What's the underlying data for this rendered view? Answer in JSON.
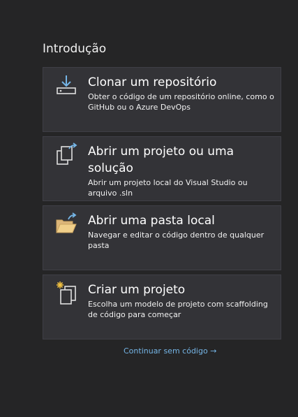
{
  "section": {
    "title": "Introdução"
  },
  "cards": [
    {
      "icon": "clone-repository-icon",
      "title": "Clonar um repositório",
      "description": "Obter o código de um repositório online, como o GitHub ou o Azure DevOps"
    },
    {
      "icon": "open-project-icon",
      "title": "Abrir um projeto ou uma solução",
      "description": "Abrir um projeto local do Visual Studio ou arquivo .sln"
    },
    {
      "icon": "open-folder-icon",
      "title": "Abrir uma pasta local",
      "description": "Navegar e editar o código dentro de qualquer pasta"
    },
    {
      "icon": "new-project-icon",
      "title": "Criar um projeto",
      "description": "Escolha um modelo de projeto com scaffolding de código para começar"
    }
  ],
  "continue_link": {
    "label": "Continuar sem código →"
  },
  "colors": {
    "background": "#252526",
    "card_background": "#333337",
    "card_border": "#3f3f46",
    "accent_blue": "#75b5e6",
    "folder_yellow": "#dcb67a"
  }
}
